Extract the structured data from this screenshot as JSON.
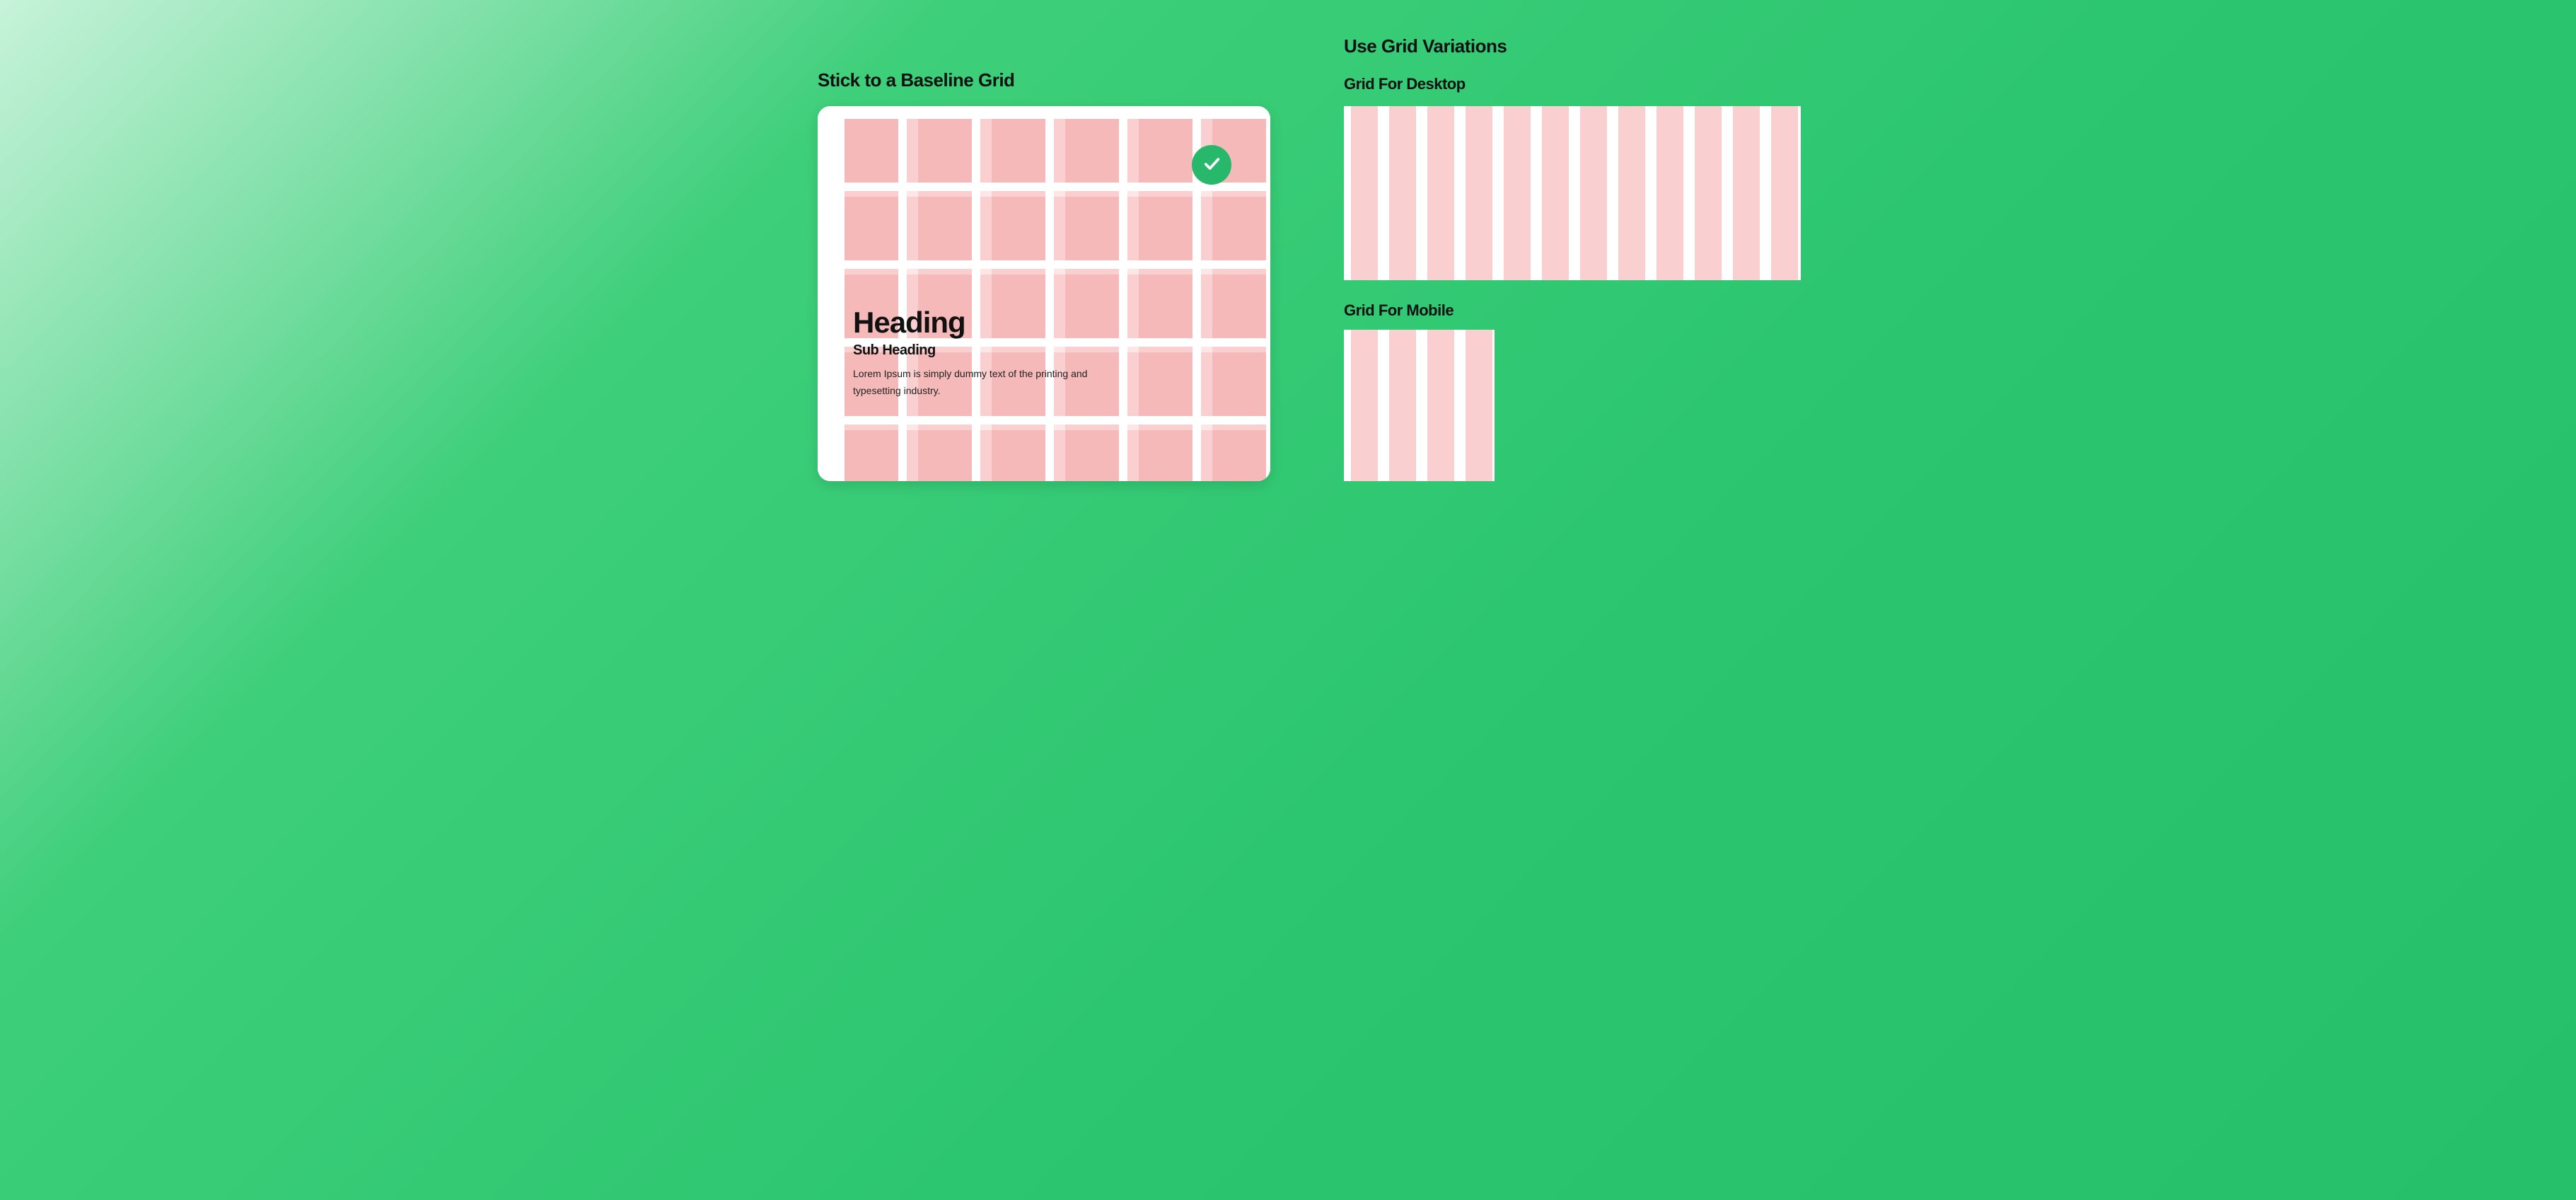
{
  "left": {
    "title": "Stick to a Baseline Grid",
    "card": {
      "heading": "Heading",
      "subheading": "Sub Heading",
      "body": "Lorem Ipsum is simply dummy text of the printing and typesetting industry."
    },
    "badge_icon": "checkmark-icon",
    "grid": {
      "columns": 6,
      "rows": 5
    }
  },
  "right": {
    "title": "Use Grid Variations",
    "desktop": {
      "label": "Grid For Desktop",
      "columns": 12
    },
    "mobile": {
      "label": "Grid For Mobile",
      "columns": 4
    }
  },
  "colors": {
    "accent_green": "#27b86b",
    "grid_pink_light": "#fde6e6",
    "grid_pink_mid": "#f9cfcf",
    "grid_pink_dark": "#f5b9b9"
  }
}
